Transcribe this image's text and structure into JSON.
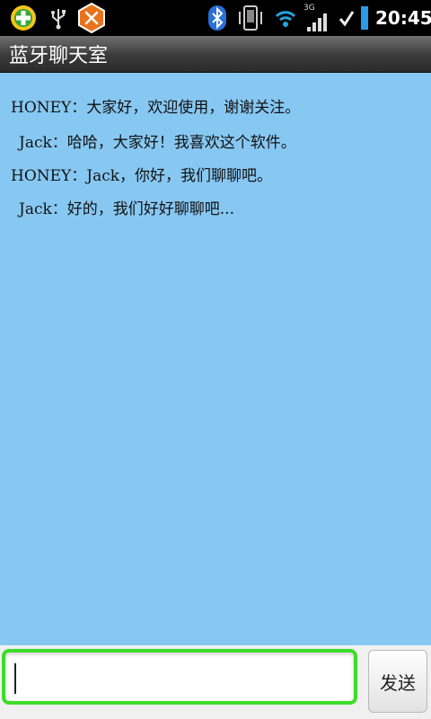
{
  "status_bar": {
    "time": "20:45",
    "network_type": "3G",
    "icons": [
      "add-app-icon",
      "usb-icon",
      "tools-icon",
      "bluetooth-icon",
      "vibrate-icon",
      "wifi-icon",
      "signal-icon",
      "check-icon",
      "battery-icon"
    ]
  },
  "title_bar": {
    "title": "蓝牙聊天室"
  },
  "chat": {
    "messages": [
      {
        "sender": "HONEY",
        "separator": "：",
        "text": "大家好，欢迎使用，谢谢关注。"
      },
      {
        "sender": "Jack",
        "separator": "：",
        "text": "哈哈，大家好！我喜欢这个软件。"
      },
      {
        "sender": "HONEY",
        "separator": "：",
        "text": "Jack，你好，我们聊聊吧。"
      },
      {
        "sender": "Jack",
        "separator": "：",
        "text": "好的，我们好好聊聊吧..."
      }
    ]
  },
  "input_bar": {
    "value": "",
    "send_label": "发送"
  },
  "colors": {
    "chat_background": "#87c8f2",
    "input_focus_border": "#3edc2a"
  }
}
